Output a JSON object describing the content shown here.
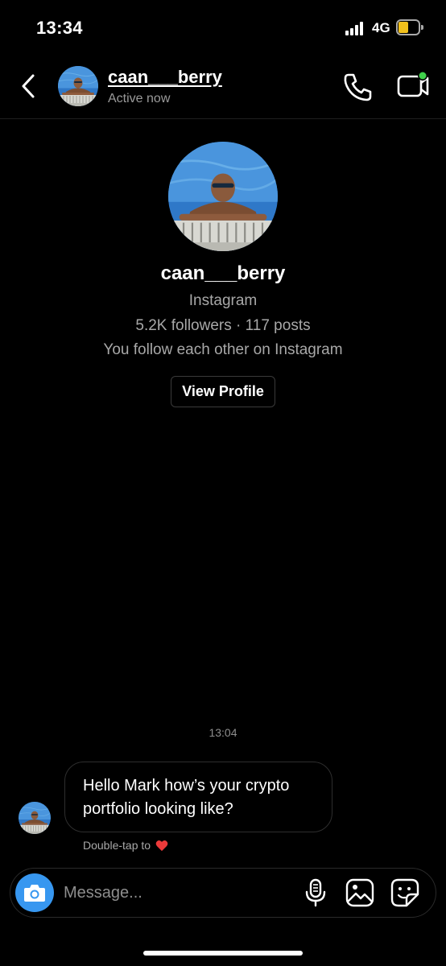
{
  "status_bar": {
    "time": "13:34",
    "network": "4G",
    "battery_color": "#f2c11c"
  },
  "header": {
    "back_icon": "chevron-left-icon",
    "username": "caan___berry",
    "status": "Active now",
    "call_icon": "phone-icon",
    "video_icon": "video-camera-icon",
    "online_indicator_color": "#3fd14a"
  },
  "profile": {
    "name": "caan___berry",
    "platform": "Instagram",
    "stats": "5.2K followers · 117 posts",
    "relationship": "You follow each other on Instagram",
    "view_profile_label": "View Profile"
  },
  "conversation": {
    "timestamp": "13:04",
    "messages": [
      {
        "text": "Hello Mark how’s your crypto portfolio looking like?"
      }
    ],
    "hint": "Double-tap to",
    "hint_icon": "heart-icon"
  },
  "composer": {
    "placeholder": "Message...",
    "accent_color": "#3797f0",
    "camera_icon": "camera-icon",
    "mic_icon": "microphone-icon",
    "gallery_icon": "gallery-icon",
    "sticker_icon": "sticker-icon"
  }
}
